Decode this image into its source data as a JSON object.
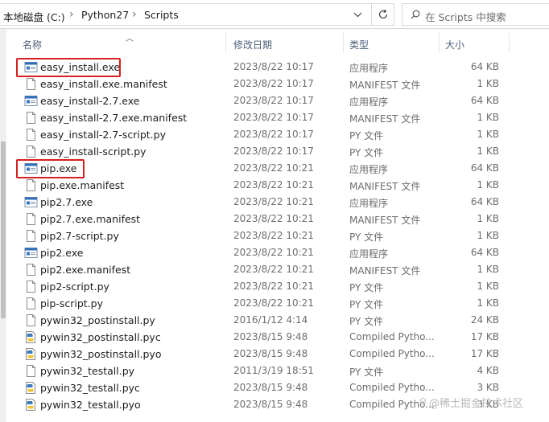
{
  "address": {
    "crumbs": [
      "本地磁盘 (C:)",
      "Python27",
      "Scripts"
    ],
    "search_placeholder": "在 Scripts 中搜索"
  },
  "columns": {
    "name": "名称",
    "date": "修改日期",
    "type": "类型",
    "size": "大小"
  },
  "files": [
    {
      "name": "easy_install.exe",
      "date": "2023/8/22 10:17",
      "type": "应用程序",
      "size": "64 KB",
      "icon": "exe-icon",
      "highlighted": true
    },
    {
      "name": "easy_install.exe.manifest",
      "date": "2023/8/22 10:17",
      "type": "MANIFEST 文件",
      "size": "1 KB",
      "icon": "file-icon"
    },
    {
      "name": "easy_install-2.7.exe",
      "date": "2023/8/22 10:17",
      "type": "应用程序",
      "size": "64 KB",
      "icon": "exe-icon"
    },
    {
      "name": "easy_install-2.7.exe.manifest",
      "date": "2023/8/22 10:17",
      "type": "MANIFEST 文件",
      "size": "1 KB",
      "icon": "file-icon"
    },
    {
      "name": "easy_install-2.7-script.py",
      "date": "2023/8/22 10:17",
      "type": "PY 文件",
      "size": "1 KB",
      "icon": "file-icon"
    },
    {
      "name": "easy_install-script.py",
      "date": "2023/8/22 10:17",
      "type": "PY 文件",
      "size": "1 KB",
      "icon": "file-icon"
    },
    {
      "name": "pip.exe",
      "date": "2023/8/22 10:21",
      "type": "应用程序",
      "size": "64 KB",
      "icon": "exe-icon",
      "highlighted": true
    },
    {
      "name": "pip.exe.manifest",
      "date": "2023/8/22 10:21",
      "type": "MANIFEST 文件",
      "size": "1 KB",
      "icon": "file-icon"
    },
    {
      "name": "pip2.7.exe",
      "date": "2023/8/22 10:21",
      "type": "应用程序",
      "size": "64 KB",
      "icon": "exe-icon"
    },
    {
      "name": "pip2.7.exe.manifest",
      "date": "2023/8/22 10:21",
      "type": "MANIFEST 文件",
      "size": "1 KB",
      "icon": "file-icon"
    },
    {
      "name": "pip2.7-script.py",
      "date": "2023/8/22 10:21",
      "type": "PY 文件",
      "size": "1 KB",
      "icon": "file-icon"
    },
    {
      "name": "pip2.exe",
      "date": "2023/8/22 10:21",
      "type": "应用程序",
      "size": "64 KB",
      "icon": "exe-icon"
    },
    {
      "name": "pip2.exe.manifest",
      "date": "2023/8/22 10:21",
      "type": "MANIFEST 文件",
      "size": "1 KB",
      "icon": "file-icon"
    },
    {
      "name": "pip2-script.py",
      "date": "2023/8/22 10:21",
      "type": "PY 文件",
      "size": "1 KB",
      "icon": "file-icon"
    },
    {
      "name": "pip-script.py",
      "date": "2023/8/22 10:21",
      "type": "PY 文件",
      "size": "1 KB",
      "icon": "file-icon"
    },
    {
      "name": "pywin32_postinstall.py",
      "date": "2016/1/12 4:14",
      "type": "PY 文件",
      "size": "24 KB",
      "icon": "file-icon"
    },
    {
      "name": "pywin32_postinstall.pyc",
      "date": "2023/8/15 9:48",
      "type": "Compiled Pytho...",
      "size": "17 KB",
      "icon": "python-compiled-icon"
    },
    {
      "name": "pywin32_postinstall.pyo",
      "date": "2023/8/15 9:48",
      "type": "Compiled Pytho...",
      "size": "17 KB",
      "icon": "python-compiled-icon"
    },
    {
      "name": "pywin32_testall.py",
      "date": "2011/3/19 18:51",
      "type": "PY 文件",
      "size": "4 KB",
      "icon": "file-icon"
    },
    {
      "name": "pywin32_testall.pyc",
      "date": "2023/8/15 9:48",
      "type": "Compiled Pytho...",
      "size": "3 KB",
      "icon": "python-compiled-icon"
    },
    {
      "name": "pywin32_testall.pyo",
      "date": "2023/8/15 9:48",
      "type": "Compiled Pytho...",
      "size": "3 KB",
      "icon": "python-compiled-icon"
    }
  ],
  "watermark": "@稀土掘金技术社区",
  "colors": {
    "highlight": "#d6201f",
    "header_text": "#4c607a",
    "secondary_text": "#6d6d6d"
  }
}
